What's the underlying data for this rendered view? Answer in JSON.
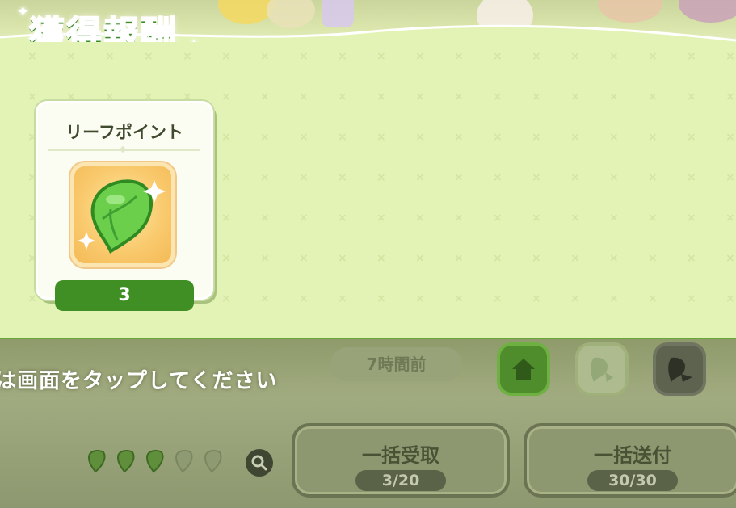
{
  "header": {
    "title": "獲得報酬"
  },
  "reward_card": {
    "item_name": "リーフポイント",
    "item_icon": "leaf-point-icon",
    "count": "3"
  },
  "background": {
    "tap_hint": "は画面をタップしてください",
    "time_badge": "7時間前",
    "buttons": {
      "bulk_receive_label": "一括受取",
      "bulk_receive_count": "3/20",
      "bulk_send_label": "一括送付",
      "bulk_send_count": "30/30"
    },
    "icons": [
      "home-icon",
      "gift-leaf-icon",
      "send-leaf-icon",
      "search-icon"
    ],
    "leaf_slots_filled": 3,
    "leaf_slots_total": 5
  },
  "colors": {
    "panel_bg": "#e3f3b6",
    "accent_green": "#3f8f24",
    "tile_orange": "#f9c96c"
  }
}
